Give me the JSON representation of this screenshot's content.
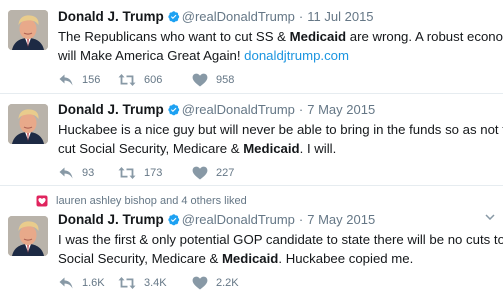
{
  "tweets": [
    {
      "author_name": "Donald J. Trump",
      "handle": "@realDonaldTrump",
      "separator": "·",
      "date": "11 Jul 2015",
      "line1_pre": "The Republicans who want to cut SS & ",
      "line1_bold": "Medicaid",
      "line1_post": " are wrong. A robust economy",
      "line2_pre": "will Make America Great Again! ",
      "line2_link": "donaldjtrump.com",
      "replies": "156",
      "retweets": "606",
      "likes": "958"
    },
    {
      "author_name": "Donald J. Trump",
      "handle": "@realDonaldTrump",
      "separator": "·",
      "date": "7 May 2015",
      "line1": "Huckabee is a nice guy but will never be able to bring in the funds so as not to",
      "line2_pre": "cut Social Security, Medicare & ",
      "line2_bold": "Medicaid",
      "line2_post": ". I will.",
      "replies": "93",
      "retweets": "173",
      "likes": "227"
    },
    {
      "context": "lauren ashley bishop and 4 others liked",
      "author_name": "Donald J. Trump",
      "handle": "@realDonaldTrump",
      "separator": "·",
      "date": "7 May 2015",
      "line1": "I was the first & only potential GOP candidate to state there will be no cuts to",
      "line2_pre": "Social Security, Medicare & ",
      "line2_bold": "Medicaid",
      "line2_post": ". Huckabee copied me.",
      "replies": "1.6K",
      "retweets": "3.4K",
      "likes": "2.2K"
    }
  ],
  "colors": {
    "text": "#14171a",
    "secondary": "#657786",
    "link": "#1b95e0",
    "verified": "#1da1f2",
    "liked_context": "#e0245e",
    "divider": "#e6ecf0"
  },
  "icons": [
    "verified-badge-icon",
    "reply-icon",
    "retweet-icon",
    "like-icon",
    "liked-heart-icon",
    "chevron-down-icon"
  ]
}
